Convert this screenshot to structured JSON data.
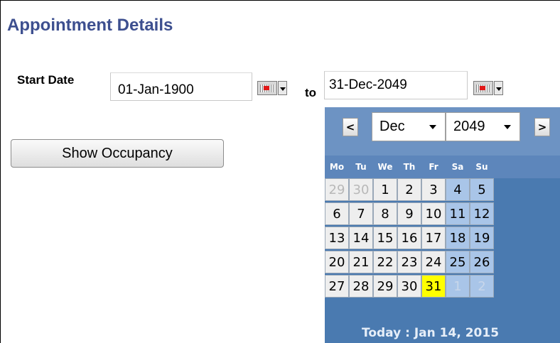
{
  "page": {
    "title": "Appointment Details",
    "start_date_label": "Start Date",
    "to_label": "to",
    "start_date_value": "01-Jan-1900",
    "end_date_value": "31-Dec-2049",
    "show_occupancy_label": "Show Occupancy",
    "calendar_button_icon": "calendar-dropdown-icon"
  },
  "calendar": {
    "prev_label": "<",
    "next_label": ">",
    "month": "Dec",
    "year": "2049",
    "weekdays": [
      "Mo",
      "Tu",
      "We",
      "Th",
      "Fr",
      "Sa",
      "Su"
    ],
    "weeks": [
      [
        "29",
        "30",
        "1",
        "2",
        "3",
        "4",
        "5"
      ],
      [
        "6",
        "7",
        "8",
        "9",
        "10",
        "11",
        "12"
      ],
      [
        "13",
        "14",
        "15",
        "16",
        "17",
        "18",
        "19"
      ],
      [
        "20",
        "21",
        "22",
        "23",
        "24",
        "25",
        "26"
      ],
      [
        "27",
        "28",
        "29",
        "30",
        "31",
        "1",
        "2"
      ]
    ],
    "selected_day": "31",
    "today_label": "Today : Jan 14, 2015",
    "colors": {
      "header": "#6d93c3",
      "weekend": "#a9c5e8",
      "weekday": "#eeeeee",
      "selected": "#ffff00"
    }
  }
}
